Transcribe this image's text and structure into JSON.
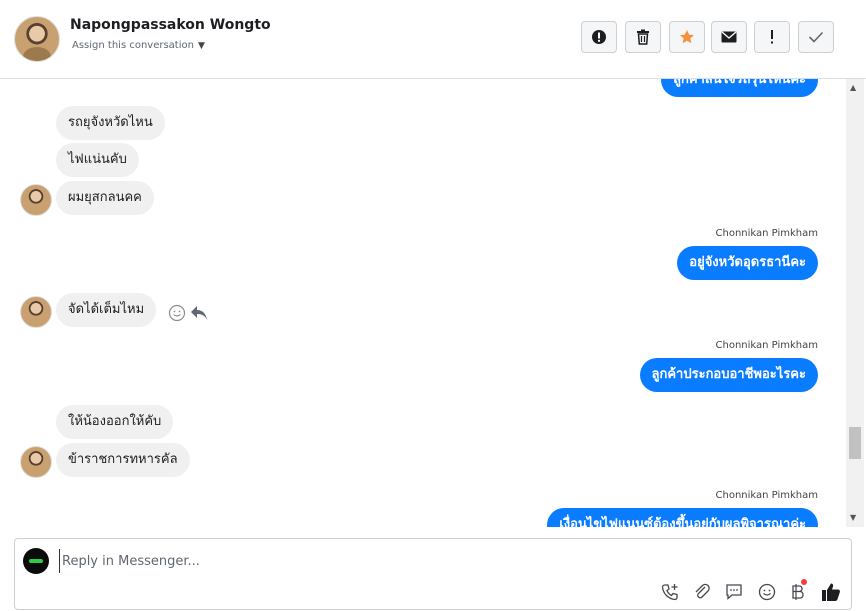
{
  "header": {
    "name": "Napongpassakon Wongto",
    "assign_label": "Assign this conversation",
    "actions": [
      {
        "name": "spam-icon",
        "label": "Mark as spam"
      },
      {
        "name": "trash-icon",
        "label": "Delete"
      },
      {
        "name": "star-icon",
        "label": "Star",
        "color": "#f5923e"
      },
      {
        "name": "mail-icon",
        "label": "Mark as unread"
      },
      {
        "name": "exclamation-icon",
        "label": "Follow up"
      },
      {
        "name": "check-icon",
        "label": "Mark as done"
      }
    ]
  },
  "messages": [
    {
      "dir": "in",
      "text": "รถยุจังหวัดไหน"
    },
    {
      "dir": "in",
      "text": "ไฟแน่นคับ"
    },
    {
      "dir": "in",
      "text": "ผมยุสกลนคค"
    },
    {
      "dir": "out",
      "sender": "Chonnikan Pimkham",
      "text": "อยู่จังหวัดอุดรธานีคะ"
    },
    {
      "dir": "in",
      "text": "จัดได้เต็มไหม"
    },
    {
      "dir": "out",
      "sender": "Chonnikan Pimkham",
      "text": "ลูกค้าประกอบอาชีพอะไรคะ"
    },
    {
      "dir": "in",
      "text": "ให้น้องออกให้คับ"
    },
    {
      "dir": "in",
      "text": "ข้าราชการทหารคัล"
    },
    {
      "dir": "out",
      "sender": "Chonnikan Pimkham",
      "text": "เงื่อนไขไฟแนนซ์ต้องขึ้นอยู่กับผลพิจารณาค่ะ"
    }
  ],
  "top_partial_message": "ลูกค้าสนใจรถรุ่นไหนคะ",
  "composer": {
    "placeholder": "Reply in Messenger...",
    "tools": [
      "phone-plus-icon",
      "attachment-icon",
      "saved-reply-icon",
      "emoji-icon",
      "payment-baht-icon",
      "thumbs-up-icon"
    ]
  },
  "colors": {
    "outgoing_bubble": "#0a7cff",
    "incoming_bubble": "#f0f0f0",
    "star": "#f5923e",
    "payment_badge": "#fa383e"
  }
}
